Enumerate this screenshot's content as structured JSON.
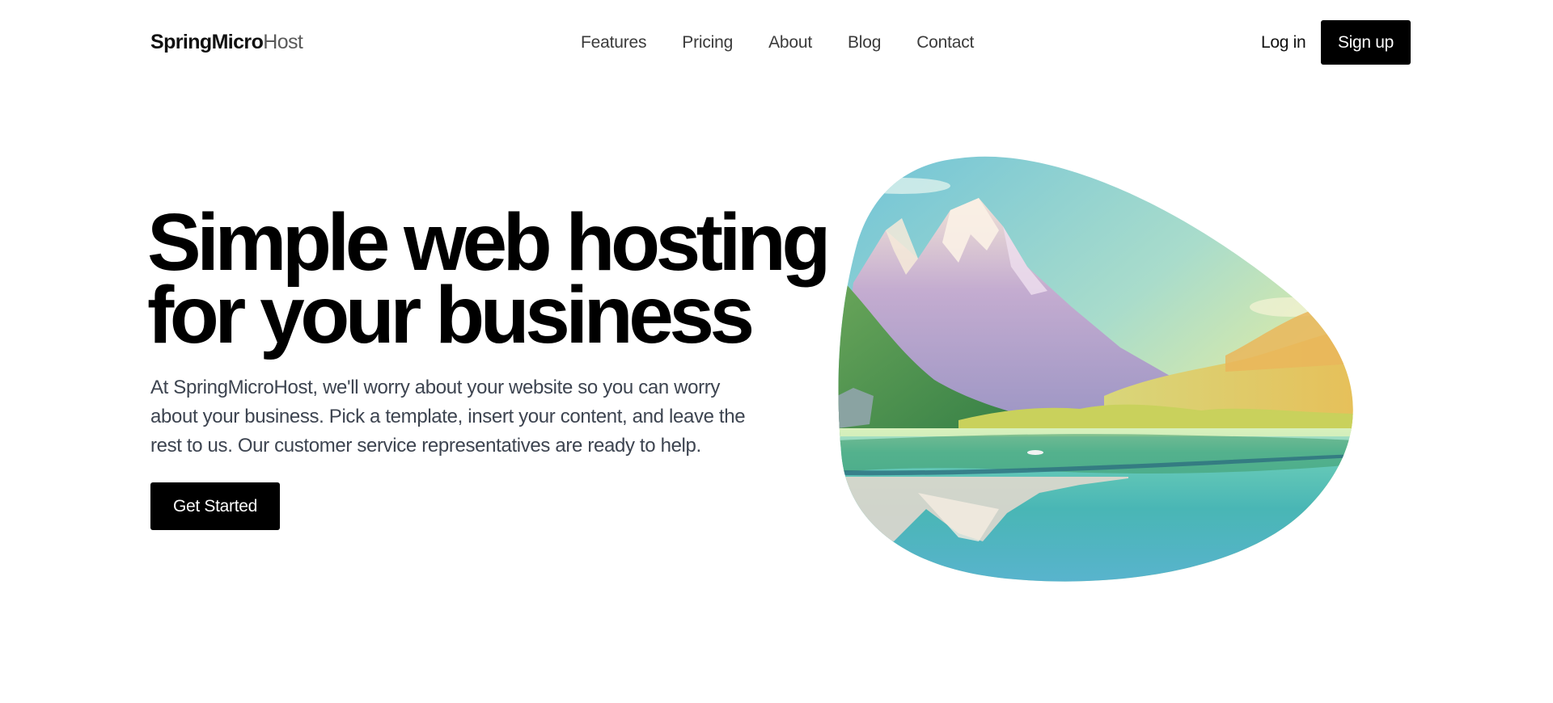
{
  "header": {
    "logo": {
      "strong": "SpringMicro",
      "light": "Host"
    },
    "nav": [
      {
        "label": "Features"
      },
      {
        "label": "Pricing"
      },
      {
        "label": "About"
      },
      {
        "label": "Blog"
      },
      {
        "label": "Contact"
      }
    ],
    "login_label": "Log in",
    "signup_label": "Sign up"
  },
  "hero": {
    "title_line1": "Simple web hosting",
    "title_line2": "for your business",
    "description": "At SpringMicroHost, we'll worry about your website so you can worry about your business. Pick a template, insert your content, and leave the rest to us. Our customer service representatives are ready to help.",
    "cta_label": "Get Started",
    "image_icon": "mountain-lake-landscape"
  },
  "colors": {
    "background": "#ffffff",
    "text_primary": "#000000",
    "text_muted": "#3d4450",
    "button_bg": "#000000",
    "button_text": "#ffffff"
  }
}
